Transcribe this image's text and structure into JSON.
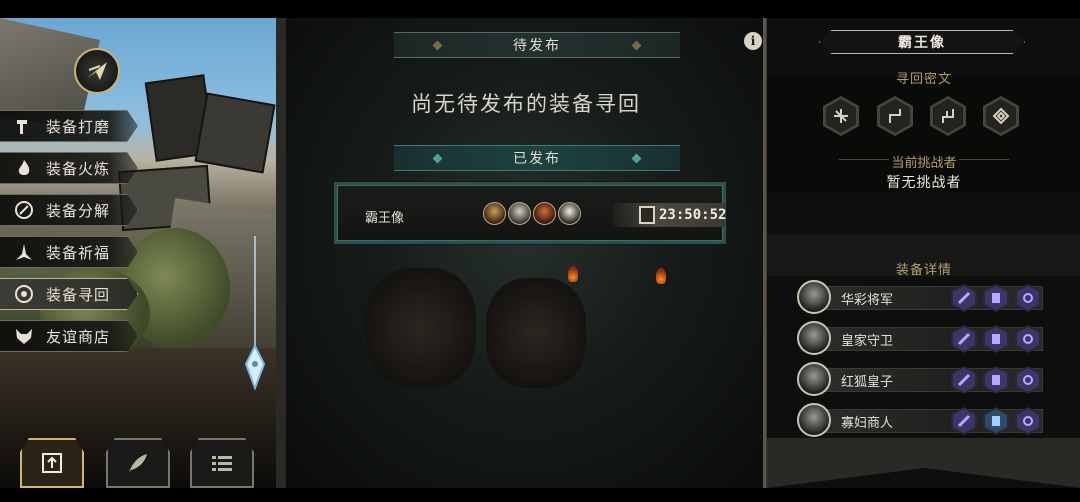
{
  "left_menu": {
    "items": [
      {
        "label": "装备打磨",
        "icon": "hammer-icon"
      },
      {
        "label": "装备火炼",
        "icon": "flame-icon"
      },
      {
        "label": "装备分解",
        "icon": "disassemble-icon"
      },
      {
        "label": "装备祈福",
        "icon": "pray-icon"
      },
      {
        "label": "装备寻回",
        "icon": "target-icon",
        "active": true
      },
      {
        "label": "友谊商店",
        "icon": "fox-icon"
      }
    ],
    "bottom_buttons": [
      {
        "icon": "upload-arrow-icon",
        "active": true
      },
      {
        "icon": "feather-icon",
        "active": false
      },
      {
        "icon": "list-icon",
        "active": false
      }
    ]
  },
  "middle": {
    "pending_header": "待发布",
    "pending_empty": "尚无待发布的装备寻回",
    "published_header": "已发布",
    "entry": {
      "name": "霸王像",
      "timer": "23:50:52"
    },
    "info_label": "i"
  },
  "right": {
    "title": "霸王像",
    "cipher_label": "寻回密文",
    "challenger_label": "当前挑战者",
    "challenger_value": "暂无挑战者",
    "details_label": "装备详情",
    "bosses": [
      {
        "name": "华彩将军",
        "equip": [
          "sword",
          "armor",
          "ring"
        ]
      },
      {
        "name": "皇家守卫",
        "equip": [
          "sword",
          "armor",
          "ring"
        ]
      },
      {
        "name": "红狐皇子",
        "equip": [
          "sword",
          "armor",
          "ring"
        ]
      },
      {
        "name": "寡妇商人",
        "equip": [
          "sword",
          "armor-blue",
          "ring"
        ]
      }
    ]
  },
  "colors": {
    "accent_gold": "#b49c6a",
    "teal": "#3f7a74",
    "equip_purple": "#3b3666"
  }
}
